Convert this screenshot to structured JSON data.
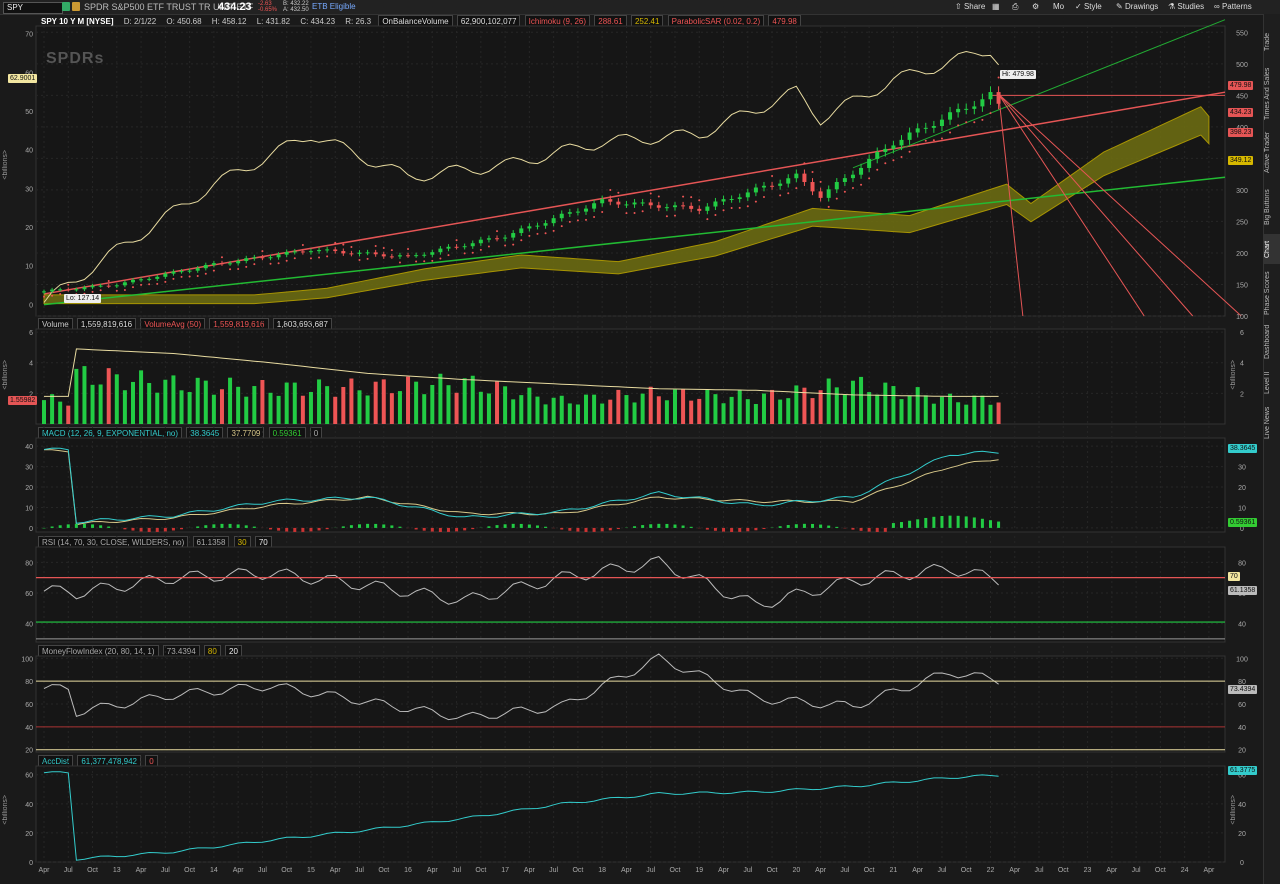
{
  "header": {
    "symbol": "SPY",
    "description": "SPDR S&P500 ETF TRUST TR UNIT ETF",
    "last": "434.23",
    "change": "-2.63",
    "change_pct": "-0.65%",
    "bid": "B: 432.22",
    "ask": "A: 432.50",
    "etb": "ETB Eligible"
  },
  "toolbar": {
    "share": "Share",
    "mo": "Mo",
    "style": "Style",
    "drawings": "Drawings",
    "studies": "Studies",
    "patterns": "Patterns"
  },
  "right_tabs": [
    "Trade",
    "Times And Sales",
    "Active Trader",
    "Big Buttons",
    "Chart",
    "Phase Scores",
    "Dashboard",
    "Level II",
    "Live News"
  ],
  "price_legend": {
    "title": "SPY 10 Y M [NYSE]",
    "date": "D: 2/1/22",
    "open": "O: 450.68",
    "high": "H: 458.12",
    "low": "L: 431.82",
    "close": "C: 434.23",
    "range": "R: 26.3",
    "obv_label": "OnBalanceVolume",
    "obv_value": "62,900,102,077",
    "ichimoku_label": "Ichimoku (9, 26)",
    "ichimoku_v1": "288.61",
    "ichimoku_v2": "252.41",
    "sar_label": "ParabolicSAR (0.02, 0.2)",
    "sar_value": "479.98"
  },
  "price_panel": {
    "hi_label": "Hi: 479.98",
    "lo_label": "Lo: 127.14",
    "left_badge": "62.9001",
    "left_unit": "<billions>",
    "right_ticks": [
      "550",
      "500",
      "450",
      "400",
      "350",
      "300",
      "250",
      "200",
      "150",
      "100"
    ],
    "left_ticks": [
      "70",
      "60",
      "50",
      "40",
      "30",
      "20",
      "10",
      "0"
    ],
    "badges": [
      {
        "text": "479.98",
        "color": "#e55555"
      },
      {
        "text": "434.23",
        "color": "#e55555"
      },
      {
        "text": "398.23",
        "color": "#e55555"
      },
      {
        "text": "349.12",
        "color": "#d6b800"
      }
    ]
  },
  "volume_legend": {
    "label": "Volume",
    "value": "1,559,819,616",
    "avg_label": "VolumeAvg (50)",
    "avg_value": "1,559,819,616",
    "avg_value2": "1,803,693,687"
  },
  "volume_panel": {
    "left_badge": "1.55982",
    "unit": "<billions>",
    "ticks": [
      "6",
      "4",
      "2"
    ]
  },
  "macd_legend": {
    "label": "MACD (12, 26, 9, EXPONENTIAL, no)",
    "v1": "38.3645",
    "v2": "37.7709",
    "v3": "0.59361",
    "v4": "0"
  },
  "macd_panel": {
    "ticks": [
      "40",
      "30",
      "20",
      "10",
      "0"
    ],
    "badge1": "38.3645",
    "badge2": "0.59361"
  },
  "rsi_legend": {
    "label": "RSI (14, 70, 30, CLOSE, WILDERS, no)",
    "v1": "61.1358",
    "v2": "30",
    "v3": "70"
  },
  "rsi_panel": {
    "ticks": [
      "80",
      "60",
      "40"
    ],
    "badge1": "70",
    "badge2": "61.1358"
  },
  "mfi_legend": {
    "label": "MoneyFlowIndex (20, 80, 14, 1)",
    "v1": "73.4394",
    "v2": "80",
    "v3": "20"
  },
  "mfi_panel": {
    "ticks": [
      "100",
      "80",
      "60",
      "40",
      "20"
    ],
    "badge1": "73.4394"
  },
  "acc_legend": {
    "label": "AccDist",
    "v1": "61,377,478,942",
    "v2": "0"
  },
  "acc_panel": {
    "ticks": [
      "60",
      "40",
      "20",
      "0"
    ],
    "badge1": "61.3775",
    "unit": "<billions>"
  },
  "x_axis": [
    "Apr",
    "Jul",
    "Oct",
    "13",
    "Apr",
    "Jul",
    "Oct",
    "14",
    "Apr",
    "Jul",
    "Oct",
    "15",
    "Apr",
    "Jul",
    "Oct",
    "16",
    "Apr",
    "Jul",
    "Oct",
    "17",
    "Apr",
    "Jul",
    "Oct",
    "18",
    "Apr",
    "Jul",
    "Oct",
    "19",
    "Apr",
    "Jul",
    "Oct",
    "20",
    "Apr",
    "Jul",
    "Oct",
    "21",
    "Apr",
    "Jul",
    "Oct",
    "22",
    "Apr",
    "Jul",
    "Oct",
    "23",
    "Apr",
    "Jul",
    "Oct",
    "24",
    "Apr"
  ],
  "chart_data": [
    {
      "type": "line",
      "title": "SPY 10 Y M [NYSE]",
      "description_note": "",
      "x": [
        "2012-04",
        "2013-01",
        "2014-01",
        "2015-01",
        "2016-01",
        "2017-01",
        "2018-01",
        "2019-01",
        "2020-01",
        "2020-04",
        "2021-01",
        "2022-01",
        "2022-02"
      ],
      "series": [
        {
          "name": "",
          "values": [
            139,
            150,
            182,
            205,
            194,
            227,
            282,
            270,
            322,
            290,
            375,
            450,
            434
          ]
        }
      ],
      "ylim": [
        100,
        560
      ]
    },
    {
      "type": "line",
      "title": "OnBalanceVolume",
      "x": [
        "2012-04",
        "2013-01",
        "2014-01",
        "2015-01",
        "2016-01",
        "2017-01",
        "2018-01",
        "2019-01",
        "2020-01",
        "2020-04",
        "2021-01",
        "2022-01",
        "2022-02"
      ],
      "series": [
        {
          "name": "OnBalanceVolume",
          "values": [
            0.5,
            14,
            31,
            44,
            33,
            36,
            42,
            44,
            55,
            48,
            58,
            66,
            62.9
          ]
        }
      ],
      "ylabel": "<billions>",
      "ylim": [
        -3,
        72
      ]
    },
    {
      "type": "bar",
      "title": "Volume",
      "x": [
        "2012",
        "2013",
        "2014",
        "2015",
        "2016",
        "2017",
        "2018",
        "2019",
        "2020",
        "2021",
        "2022"
      ],
      "values": [
        3.2,
        2.6,
        2.3,
        2.4,
        2.7,
        1.5,
        2.0,
        1.7,
        2.6,
        1.6,
        1.56
      ],
      "series": [
        {
          "name": "VolumeAvg (50)",
          "values": [
            4.9,
            4.6,
            4.0,
            3.3,
            2.9,
            2.6,
            2.3,
            2.2,
            1.9,
            1.8,
            1.8
          ]
        }
      ],
      "ylabel": "<billions>",
      "ylim": [
        0,
        6.2
      ]
    },
    {
      "type": "line",
      "title": "MACD (12, 26, 9, EXPONENTIAL, no)",
      "x": [
        "2012",
        "2013",
        "2014",
        "2015",
        "2016",
        "2017",
        "2018",
        "2019",
        "2020",
        "2021",
        "2022"
      ],
      "series": [
        {
          "name": "",
          "values": [
            3,
            6,
            13,
            15,
            5,
            8,
            17,
            11,
            15,
            36,
            38.36
          ]
        },
        {
          "name": "",
          "values": [
            2,
            5,
            11,
            15,
            7,
            7,
            15,
            13,
            13,
            30,
            37.77
          ]
        }
      ],
      "ylim": [
        -2,
        44
      ]
    },
    {
      "type": "line",
      "title": "RSI (14, 70, 30, CLOSE, WILDERS, no)",
      "x": [
        "2012",
        "2013",
        "2014",
        "2015",
        "2016",
        "2017",
        "2018",
        "2019",
        "2020",
        "2021",
        "2022"
      ],
      "series": [
        {
          "name": "",
          "values": [
            60,
            70,
            73,
            65,
            55,
            70,
            80,
            52,
            68,
            76,
            61.14
          ]
        }
      ],
      "ylim": [
        28,
        90
      ]
    },
    {
      "type": "line",
      "title": "MoneyFlowIndex (20, 80, 14, 1)",
      "x": [
        "2012",
        "2013",
        "2014",
        "2015",
        "2016",
        "2017",
        "2018",
        "2019",
        "2020",
        "2021",
        "2022"
      ],
      "series": [
        {
          "name": "",
          "values": [
            53,
            68,
            76,
            62,
            48,
            58,
            100,
            65,
            58,
            88,
            73.44
          ]
        }
      ],
      "ylim": [
        18,
        102
      ]
    },
    {
      "type": "line",
      "title": "AccDist",
      "x": [
        "2012",
        "2013",
        "2014",
        "2015",
        "2016",
        "2017",
        "2018",
        "2019",
        "2020",
        "2021",
        "2022"
      ],
      "series": [
        {
          "name": "AccDist",
          "values": [
            2,
            7,
            15,
            22,
            30,
            40,
            47,
            48,
            52,
            58,
            61.38
          ]
        }
      ],
      "ylabel": "<billions>",
      "ylim": [
        0,
        66
      ]
    }
  ]
}
